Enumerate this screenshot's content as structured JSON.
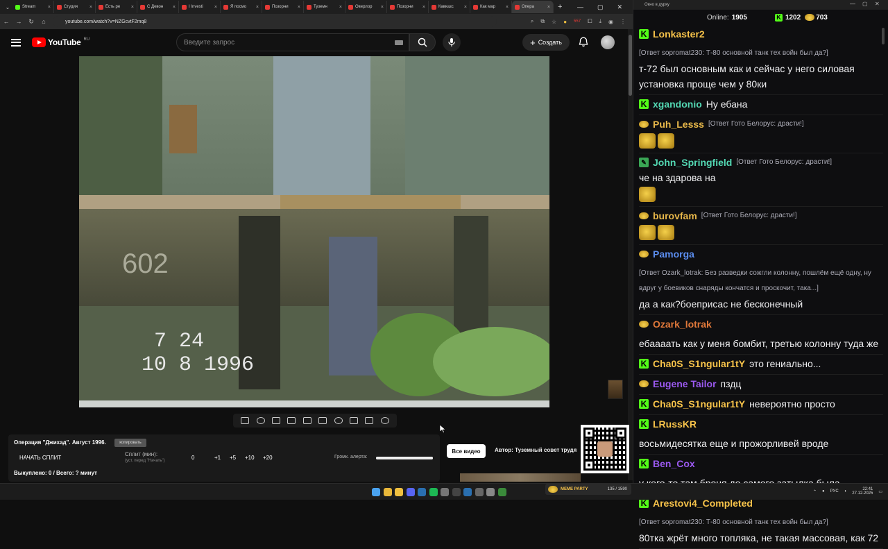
{
  "browser": {
    "tabs": [
      {
        "label": "Stream",
        "color": "#53fc18"
      },
      {
        "label": "Студия",
        "color": "#e53935"
      },
      {
        "label": "Есть ре",
        "color": "#e53935"
      },
      {
        "label": "С Девон",
        "color": "#e53935"
      },
      {
        "label": "I Investi",
        "color": "#e53935"
      },
      {
        "label": "Я посмо",
        "color": "#e53935"
      },
      {
        "label": "Позорни",
        "color": "#e53935"
      },
      {
        "label": "Туземн",
        "color": "#e53935"
      },
      {
        "label": "Оверлор",
        "color": "#e53935"
      },
      {
        "label": "Позорни",
        "color": "#e53935"
      },
      {
        "label": "Кавказс",
        "color": "#e53935"
      },
      {
        "label": "Как мар",
        "color": "#e53935"
      },
      {
        "label": "Опера",
        "color": "#e53935"
      }
    ],
    "new_tab": "+",
    "url": "youtube.com/watch?v=NZGcvtF2mq8",
    "ext_badge": "557"
  },
  "youtube": {
    "logo_word": "YouTube",
    "logo_region": "RU",
    "search_placeholder": "Введите запрос",
    "create_label": "Создать"
  },
  "video": {
    "overlay_time": "7 24",
    "overlay_date": "10 8 1996",
    "plate": "602"
  },
  "panel": {
    "title": "Операция \"Джихад\". Август 1996.",
    "copy_label": "копировать",
    "start_split": "НАЧАТЬ СПЛИТ",
    "split_label": "Сплит (мин):",
    "split_hint": "(уст. перед \"Начать\")",
    "split_value": "0",
    "increments": [
      "+1",
      "+5",
      "+10",
      "+20"
    ],
    "alert_volume_label": "Громк. алерта:",
    "alert_volume": 1.0,
    "bought": "Выкуплено: 0 / Всего: ? минут"
  },
  "controls": {
    "all_videos": "Все видео",
    "author": "Автор: Туземный совет трудя"
  },
  "chat": {
    "window_title": "Окно в дурку",
    "online_label": "Online:",
    "online_count": "1905",
    "kick_count": "1202",
    "gold_count": "703",
    "messages": [
      {
        "user": "Lonkaster2",
        "color": "#f7c34a",
        "badge": "kick",
        "reply": "[Ответ sopromat230: Т-80 основной танк тех войн был да?]",
        "text": "т-72 был основным как и сейчас у него силовая установка проще чем у 80ки",
        "emotes": 0
      },
      {
        "user": "xgandonio",
        "color": "#53d8b3",
        "badge": "kick",
        "reply": "",
        "text": "Ну ебана",
        "emotes": 0
      },
      {
        "user": "Puh_Lesss",
        "color": "#e8b84a",
        "badge": "gold",
        "reply": "[Ответ Гото Белорус: драсти!]",
        "text": "",
        "emotes": 2
      },
      {
        "user": "John_Springfield",
        "color": "#53d8b3",
        "badge": "pencil",
        "reply": "[Ответ Гото Белорус: драсти!]",
        "text": "че на здарова на",
        "emotes": 1
      },
      {
        "user": "burovfam",
        "color": "#e8b84a",
        "badge": "gold",
        "reply": "[Ответ Гото Белорус: драсти!]",
        "text": "",
        "emotes": 2
      },
      {
        "user": "Pamorga",
        "color": "#5b8def",
        "badge": "gold",
        "reply": "[Ответ Ozark_lotrak: Без разведки сожгли колонну, пошлём ещё одну, ну вдруг у боевиков снаряды кончатся и проскочит, така...]",
        "text": "да а как?боеприсас не бесконечный",
        "emotes": 0
      },
      {
        "user": "Ozark_lotrak",
        "color": "#e0783a",
        "badge": "gold",
        "reply": "",
        "text": "ебаааать как у меня бомбит, третью колонну туда же",
        "emotes": 0
      },
      {
        "user": "Cha0S_S1ngular1tY",
        "color": "#f7c34a",
        "badge": "kick",
        "reply": "",
        "text": "это гениально...",
        "emotes": 0
      },
      {
        "user": "Eugene Tailor",
        "color": "#9b59f0",
        "badge": "gold",
        "reply": "",
        "text": "пздц",
        "emotes": 0
      },
      {
        "user": "Cha0S_S1ngular1tY",
        "color": "#f7c34a",
        "badge": "kick",
        "reply": "",
        "text": "невероятно просто",
        "emotes": 0
      },
      {
        "user": "LRussKR",
        "color": "#f7c34a",
        "badge": "kick",
        "reply": "",
        "text": "восьмидесятка еще и прожорливей вроде",
        "emotes": 0
      },
      {
        "user": "Ben_Cox",
        "color": "#9b59f0",
        "badge": "kick",
        "reply": "",
        "text": "у кого-то там броня до самого затылка была....",
        "emotes": 0
      },
      {
        "user": "Arestovi4_Completed",
        "color": "#f7c34a",
        "badge": "kick",
        "reply": "[Ответ sopromat230: Т-80 основной танк тех войн был да?]",
        "text": "80тка жрёт много топляка, не такая массовая, как 72",
        "emotes": 0
      }
    ]
  },
  "taskbar": {
    "lang": "РУС",
    "time": "22:41",
    "date": "27.12.2025",
    "meme_label": "MEME PARTY",
    "meme_stats": "135 / 1590"
  }
}
